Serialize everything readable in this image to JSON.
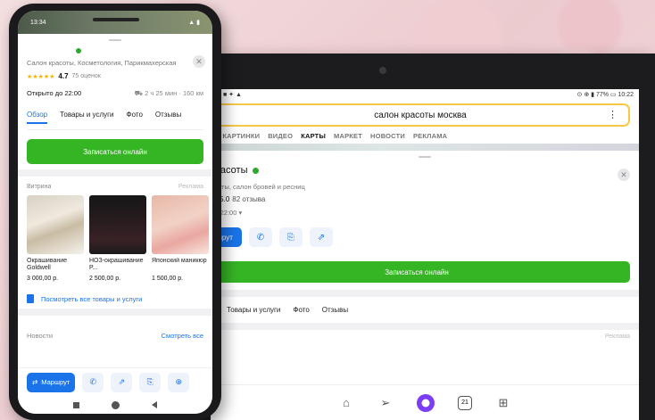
{
  "tablet": {
    "status_time": "10:22",
    "status_battery": "77%",
    "search_value": "салон красоты москва",
    "nav": [
      "ТЫ",
      "КАРТИНКИ",
      "ВИДЕО",
      "КАРТЫ",
      "МАРКЕТ",
      "НОВОСТИ",
      "РЕКЛАМА"
    ],
    "nav_active": "КАРТЫ",
    "title": "красоты",
    "subtitle": "асоты, салон бровей и ресниц",
    "rating": "5.0",
    "rating_count": "82 отзыва",
    "hours": "до 22:00",
    "route_label": "ршрут",
    "book_label": "Записаться онлайн",
    "tabs": [
      "Товары и услуги",
      "Фото",
      "Отзывы"
    ],
    "witrina_ad": "Реклама",
    "bottom_icons": [
      "home-icon",
      "send-icon",
      "alice-icon",
      "calendar-icon",
      "apps-icon"
    ],
    "calendar_day": "21"
  },
  "phone": {
    "status_time": "13:34",
    "categories": "Салон красоты, Косметология, Парикмахерская",
    "rating": "4.7",
    "rating_count": "75 оценок",
    "open_status": "Открыто до 22:00",
    "distance": "2 ч 25 мин · 160 км",
    "tabs": [
      "Обзор",
      "Товары и услуги",
      "Фото",
      "Отзывы"
    ],
    "book_label": "Записаться онлайн",
    "witrina_title": "Витрина",
    "witrina_ad": "Реклама",
    "products": [
      {
        "name": "Окрашивание Goldwell",
        "price": "3 000,00 р."
      },
      {
        "name": "НОЗ-окрашивание Р...",
        "price": "2 500,00 р."
      },
      {
        "name": "Японский маникюр",
        "price": "1 500,00 р."
      }
    ],
    "all_products": "Посмотреть все товары и услуги",
    "news_title": "Новости",
    "news_link": "Смотреть все",
    "route_label": "Маршрут"
  },
  "colors": {
    "accent_blue": "#1a73e8",
    "book_green": "#35b524",
    "search_border": "#f6c945",
    "alice_purple": "#7b3ef2"
  }
}
